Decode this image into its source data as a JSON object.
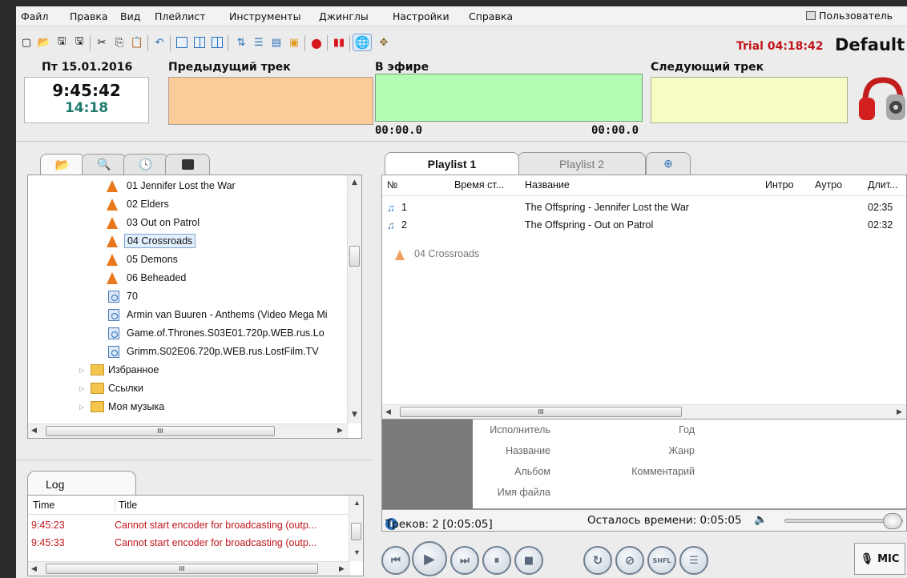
{
  "menu": [
    "Файл",
    "Правка",
    "Вид",
    "Плейлист",
    "Инструменты",
    "Джинглы",
    "Настройки",
    "Справка"
  ],
  "user_label": "Пользователь",
  "trial_text": "Trial 04:18:42",
  "profile_name": "Default",
  "date_label": "Пт 15.01.2016",
  "clock_time": "9:45:42",
  "clock_remaining": "14:18",
  "prev_label": "Предыдущий трек",
  "onair_label": "В эфире",
  "next_label": "Следующий трек",
  "onair_elapsed": "00:00.0",
  "onair_remaining": "00:00.0",
  "browser_tree": [
    {
      "label": "01 Jennifer Lost the War",
      "icon": "vlc-cone-icon",
      "selected": false
    },
    {
      "label": "02 Elders",
      "icon": "vlc-cone-icon",
      "selected": false
    },
    {
      "label": "03 Out on Patrol",
      "icon": "vlc-cone-icon",
      "selected": false
    },
    {
      "label": "04 Crossroads",
      "icon": "vlc-cone-icon",
      "selected": true
    },
    {
      "label": "05 Demons",
      "icon": "vlc-cone-icon",
      "selected": false
    },
    {
      "label": "06 Beheaded",
      "icon": "vlc-cone-icon",
      "selected": false
    },
    {
      "label": "70",
      "icon": "video-file-icon",
      "selected": false
    },
    {
      "label": "Armin van Buuren - Anthems (Video Mega Mi",
      "icon": "video-file-icon",
      "selected": false
    },
    {
      "label": "Game.of.Thrones.S03E01.720p.WEB.rus.Lo",
      "icon": "video-file-icon",
      "selected": false
    },
    {
      "label": "Grimm.S02E06.720p.WEB.rus.LostFilm.TV",
      "icon": "video-file-icon",
      "selected": false
    }
  ],
  "browser_folders": [
    "Избранное",
    "Ссылки",
    "Моя музыка"
  ],
  "hscroll_glyph": "III",
  "log": {
    "tab_label": "Log",
    "col_time": "Time",
    "col_title": "Title",
    "rows": [
      {
        "time": "9:45:23",
        "title": "Cannot start encoder for broadcasting (outp..."
      },
      {
        "time": "9:45:33",
        "title": "Cannot start encoder for broadcasting (outp..."
      }
    ]
  },
  "playlist_tabs": [
    "Playlist 1",
    "Playlist 2"
  ],
  "playlist_cols": {
    "num": "№",
    "start": "Время ст...",
    "title": "Название",
    "intro": "Интро",
    "outro": "Аутро",
    "dur": "Длит..."
  },
  "playlist_rows": [
    {
      "num": "1",
      "title": "The Offspring - Jennifer Lost the War",
      "dur": "02:35"
    },
    {
      "num": "2",
      "title": "The Offspring - Out on Patrol",
      "dur": "02:32"
    }
  ],
  "drag_item": "04 Crossroads",
  "track_info": {
    "artist": "Исполнитель",
    "title": "Название",
    "album": "Альбом",
    "filename": "Имя файла",
    "year": "Год",
    "genre": "Жанр",
    "comment": "Комментарий"
  },
  "status": {
    "tracks": "Треков: 2 [0:05:05]",
    "remaining": "Осталось времени: 0:05:05",
    "volume_fraction": 0.95
  },
  "controls": {
    "shfl_label": "SHFL",
    "mic_label": "MIC"
  }
}
